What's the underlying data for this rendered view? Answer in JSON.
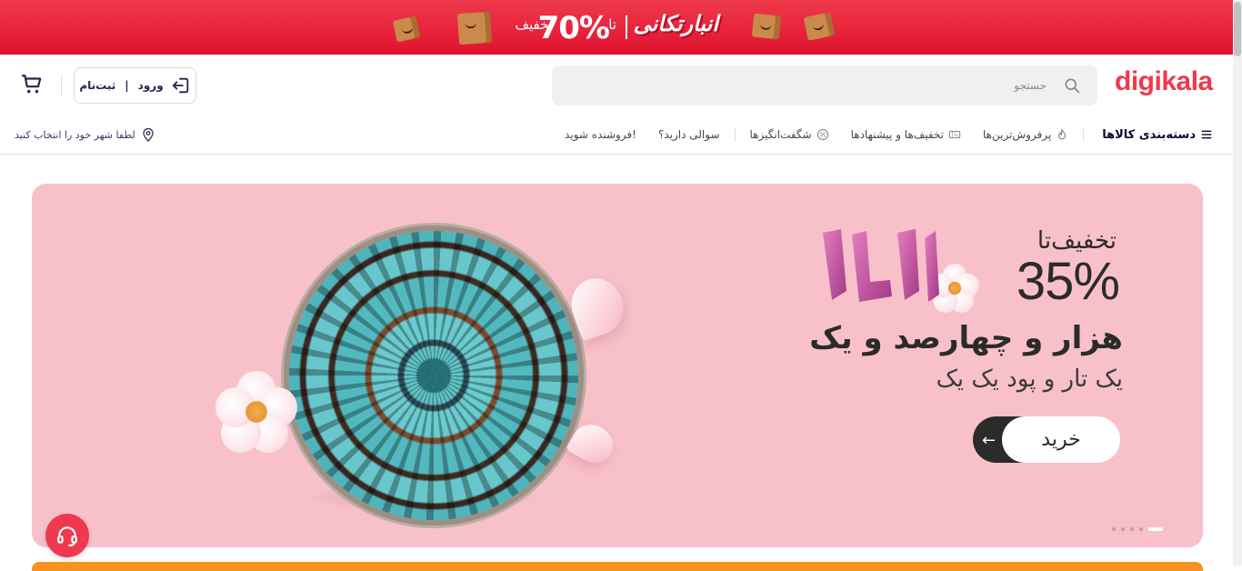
{
  "promo": {
    "discount_word": "تخفیف",
    "percent": "70%",
    "prefix": "تا",
    "brand": "انبارتکانی"
  },
  "header": {
    "logo": "digikala",
    "search_placeholder": "جستجو",
    "login": "ورود",
    "login_sep": "|",
    "register": "ثبت‌نام"
  },
  "nav": {
    "categories": "دسته‌بندی کالاها",
    "items": [
      {
        "label": "پرفروش‌ترین‌ها",
        "icon": "fire-icon"
      },
      {
        "label": "تخفیف‌ها و پیشنهادها",
        "icon": "coupon-icon"
      },
      {
        "label": "شگفت‌انگیزها",
        "icon": "percent-icon"
      },
      {
        "label": "سوالی دارید؟",
        "icon": ""
      },
      {
        "label": "فروشنده شوید!",
        "icon": ""
      }
    ],
    "location": "لطفا شهر خود را انتخاب کنید"
  },
  "hero": {
    "discount_word": "تخفیف‌تا",
    "percent": "35%",
    "title": "هزار و چهارصد و یک",
    "subtitle": "یک تار و پود یک یک",
    "button": "خرید",
    "badge_number": "1404",
    "slides_total": 5,
    "slide_active": 1
  },
  "colors": {
    "brand": "#ef394e",
    "hero_bg": "#f8c1ca",
    "promo_bg": "#e0122e"
  }
}
